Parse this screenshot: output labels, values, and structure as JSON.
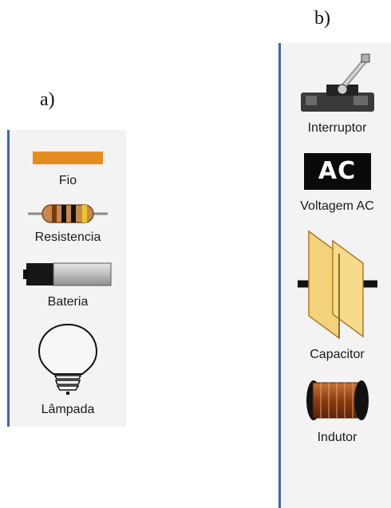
{
  "panel_a": {
    "label": "a)",
    "items": [
      {
        "label": "Fio",
        "icon": "wire-icon"
      },
      {
        "label": "Resistencia",
        "icon": "resistor-icon"
      },
      {
        "label": "Bateria",
        "icon": "battery-icon"
      },
      {
        "label": "Lâmpada",
        "icon": "lightbulb-icon"
      }
    ]
  },
  "panel_b": {
    "label": "b)",
    "items": [
      {
        "label": "Interruptor",
        "icon": "switch-icon"
      },
      {
        "label": "Voltagem AC",
        "icon": "ac-source-icon",
        "badge_text": "AC"
      },
      {
        "label": "Capacitor",
        "icon": "capacitor-icon"
      },
      {
        "label": "Indutor",
        "icon": "inductor-icon"
      }
    ]
  },
  "colors": {
    "toolbox_background": "#f3f3f3",
    "toolbox_border": "#3f66a8",
    "wire": "#e58c1e",
    "capacitor_plate": "#f2d27a"
  }
}
